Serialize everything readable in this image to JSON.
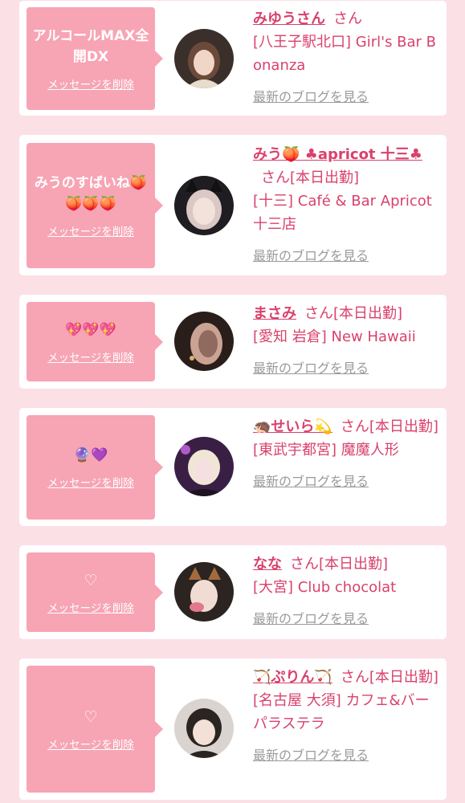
{
  "entries": [
    {
      "message": "アルコールMAX全開DX",
      "delete_label": "メッセージを削除",
      "name": "みゆうさん",
      "san": "さん",
      "status": "",
      "shop": "[八王子駅北口] Girl's Bar Bonanza",
      "blog_label": "最新のブログを見る"
    },
    {
      "message": "みうのすばいね🍑🍑🍑🍑",
      "delete_label": "メッセージを削除",
      "name": "みう🍑 ♣apricot 十三♣",
      "san": "さん",
      "status": "[本日出勤]",
      "shop": "[十三] Café & Bar Apricot 十三店",
      "blog_label": "最新のブログを見る"
    },
    {
      "message": "💖💖💖",
      "delete_label": "メッセージを削除",
      "name": "まさみ",
      "san": "さん",
      "status": "[本日出勤]",
      "shop": "[愛知 岩倉] New Hawaii",
      "blog_label": "最新のブログを見る"
    },
    {
      "message": "🔮💜",
      "delete_label": "メッセージを削除",
      "name": "🦔せいら💫",
      "san": "さん",
      "status": "[本日出勤]",
      "shop": "[東武宇都宮] 魔魔人形",
      "blog_label": "最新のブログを見る"
    },
    {
      "message": "♡",
      "delete_label": "メッセージを削除",
      "name": "なな",
      "san": "さん",
      "status": "[本日出勤]",
      "shop": "[大宮] Club chocolat",
      "blog_label": "最新のブログを見る"
    },
    {
      "message": "♡",
      "delete_label": "メッセージを削除",
      "name": "🏹ぷりん🏹",
      "san": "さん",
      "status": "[本日出勤]",
      "shop": "[名古屋 大須] カフェ&バー パラステラ",
      "blog_label": "最新のブログを見る"
    }
  ],
  "colors": {
    "page_background": "#fbe0e6",
    "card_background": "#ffffff",
    "bubble": "#f7a4b4",
    "accent_text": "#d9416c",
    "muted_link": "#9a9a9a"
  }
}
